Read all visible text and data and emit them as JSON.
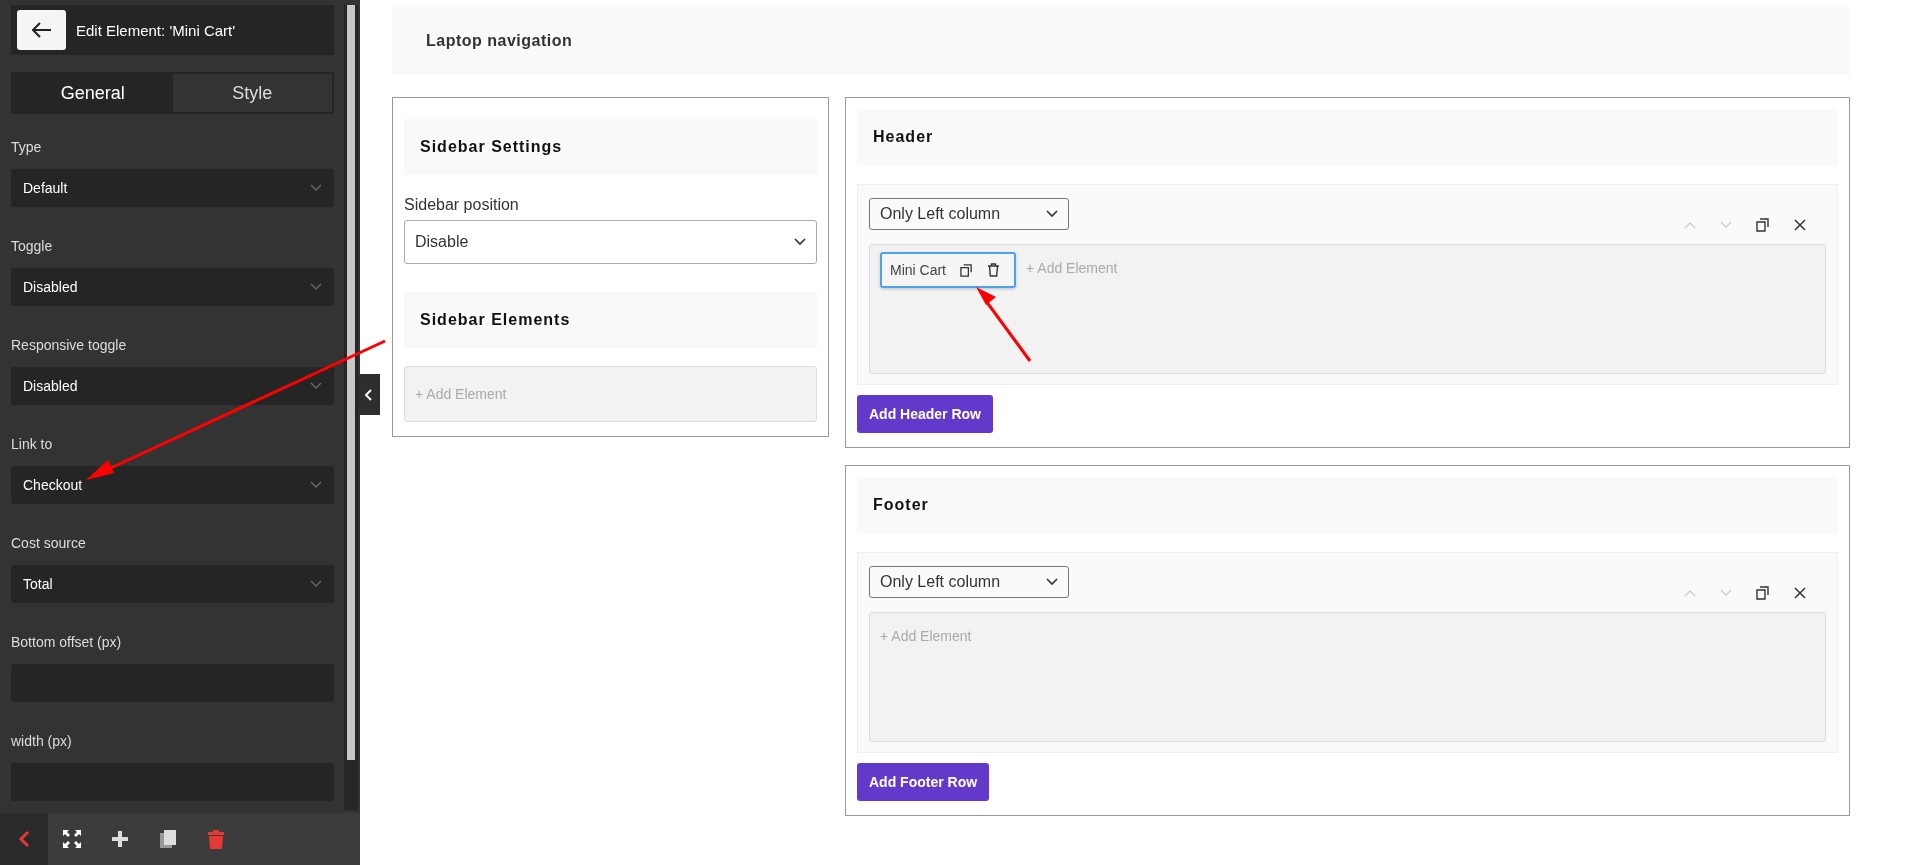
{
  "editor_panel": {
    "title": "Edit Element: 'Mini Cart'",
    "tabs": [
      {
        "label": "General",
        "selected": true
      },
      {
        "label": "Style",
        "selected": false
      }
    ],
    "fields": [
      {
        "kind": "select",
        "label": "Type",
        "value": "Default"
      },
      {
        "kind": "select",
        "label": "Toggle",
        "value": "Disabled"
      },
      {
        "kind": "select",
        "label": "Responsive toggle",
        "value": "Disabled"
      },
      {
        "kind": "select",
        "label": "Link to",
        "value": "Checkout"
      },
      {
        "kind": "select",
        "label": "Cost source",
        "value": "Total"
      },
      {
        "kind": "input",
        "label": "Bottom offset (px)"
      },
      {
        "kind": "input",
        "label": "width (px)"
      }
    ]
  },
  "page_title": "Laptop navigation",
  "sidebar": {
    "settings_title": "Sidebar Settings",
    "position_label": "Sidebar position",
    "position_value": "Disable",
    "elements_title": "Sidebar Elements",
    "add_element": "+ Add Element"
  },
  "sections": [
    {
      "title": "Header",
      "layout": "Only Left column",
      "elements": [
        {
          "label": "Mini Cart",
          "selected": true
        }
      ],
      "add_element": "+ Add Element",
      "add_row_button": "Add Header Row"
    },
    {
      "title": "Footer",
      "layout": "Only Left column",
      "add_element": "+ Add Element",
      "add_row_button": "Add Footer Row"
    }
  ]
}
